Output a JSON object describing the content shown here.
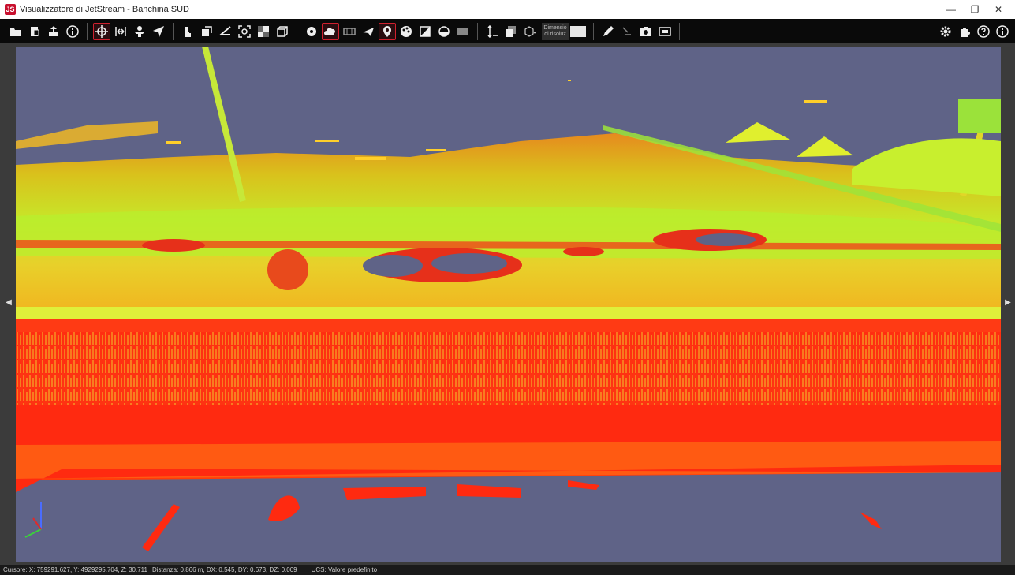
{
  "window": {
    "title": "Visualizzatore di JetStream - Banchina SUD",
    "app_icon_letter": "JS",
    "controls": {
      "minimize": "—",
      "maximize": "❐",
      "close": "✕"
    }
  },
  "toolbar": {
    "size_label_line1": "Dimensio",
    "size_label_line2": "di risoluz",
    "accent_color": "#d0202e"
  },
  "viewport": {
    "background_color": "#5f6387",
    "left_arrow": "◀",
    "right_arrow": "▶"
  },
  "status": {
    "cursor": "Cursore: X: 759291.627, Y: 4929295.704, Z: 30.711",
    "distance": "Distanza: 0.866 m, DX: 0.545, DY: 0.673, DZ: 0.009",
    "ucs": "UCS: Valore predefinito"
  }
}
